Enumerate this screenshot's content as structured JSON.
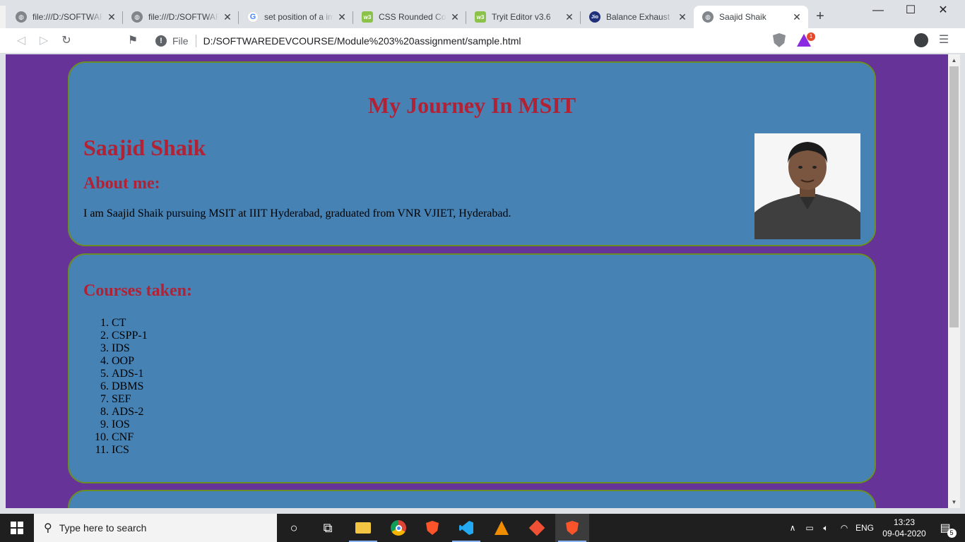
{
  "browser": {
    "tabs": [
      {
        "title": "file:///D:/SOFTWAREDEVCOURSE",
        "favicon": "globe-icon"
      },
      {
        "title": "file:///D:/SOFTWAREDEVCOURSE",
        "favicon": "globe-icon"
      },
      {
        "title": "set position of a image",
        "favicon": "google-icon"
      },
      {
        "title": "CSS Rounded Corners",
        "favicon": "w3schools-icon"
      },
      {
        "title": "Tryit Editor v3.6",
        "favicon": "w3schools-icon"
      },
      {
        "title": "Balance Exhaust",
        "favicon": "jio-icon"
      },
      {
        "title": "Saajid Shaik",
        "favicon": "globe-icon",
        "active": true
      }
    ],
    "address": {
      "scheme_label": "File",
      "url": "D:/SOFTWAREDEVCOURSE/Module%203%20assignment/sample.html"
    },
    "rewards_badge": "1"
  },
  "page": {
    "background": "#663399",
    "card_color": "#4682b4",
    "heading_color": "#b22234",
    "intro": {
      "title": "My Journey In MSIT",
      "name": "Saajid Shaik",
      "about_heading": "About me:",
      "about_text": "I am Saajid Shaik pursuing MSIT at IIIT Hyderabad, graduated from VNR VJIET, Hyderabad."
    },
    "courses": {
      "heading": "Courses taken:",
      "items": [
        "CT",
        "CSPP-1",
        "IDS",
        "OOP",
        "ADS-1",
        "DBMS",
        "SEF",
        "ADS-2",
        "IOS",
        "CNF",
        "ICS"
      ]
    }
  },
  "taskbar": {
    "search_placeholder": "Type here to search",
    "language": "ENG",
    "time": "13:23",
    "date": "09-04-2020",
    "notification_count": "5"
  }
}
